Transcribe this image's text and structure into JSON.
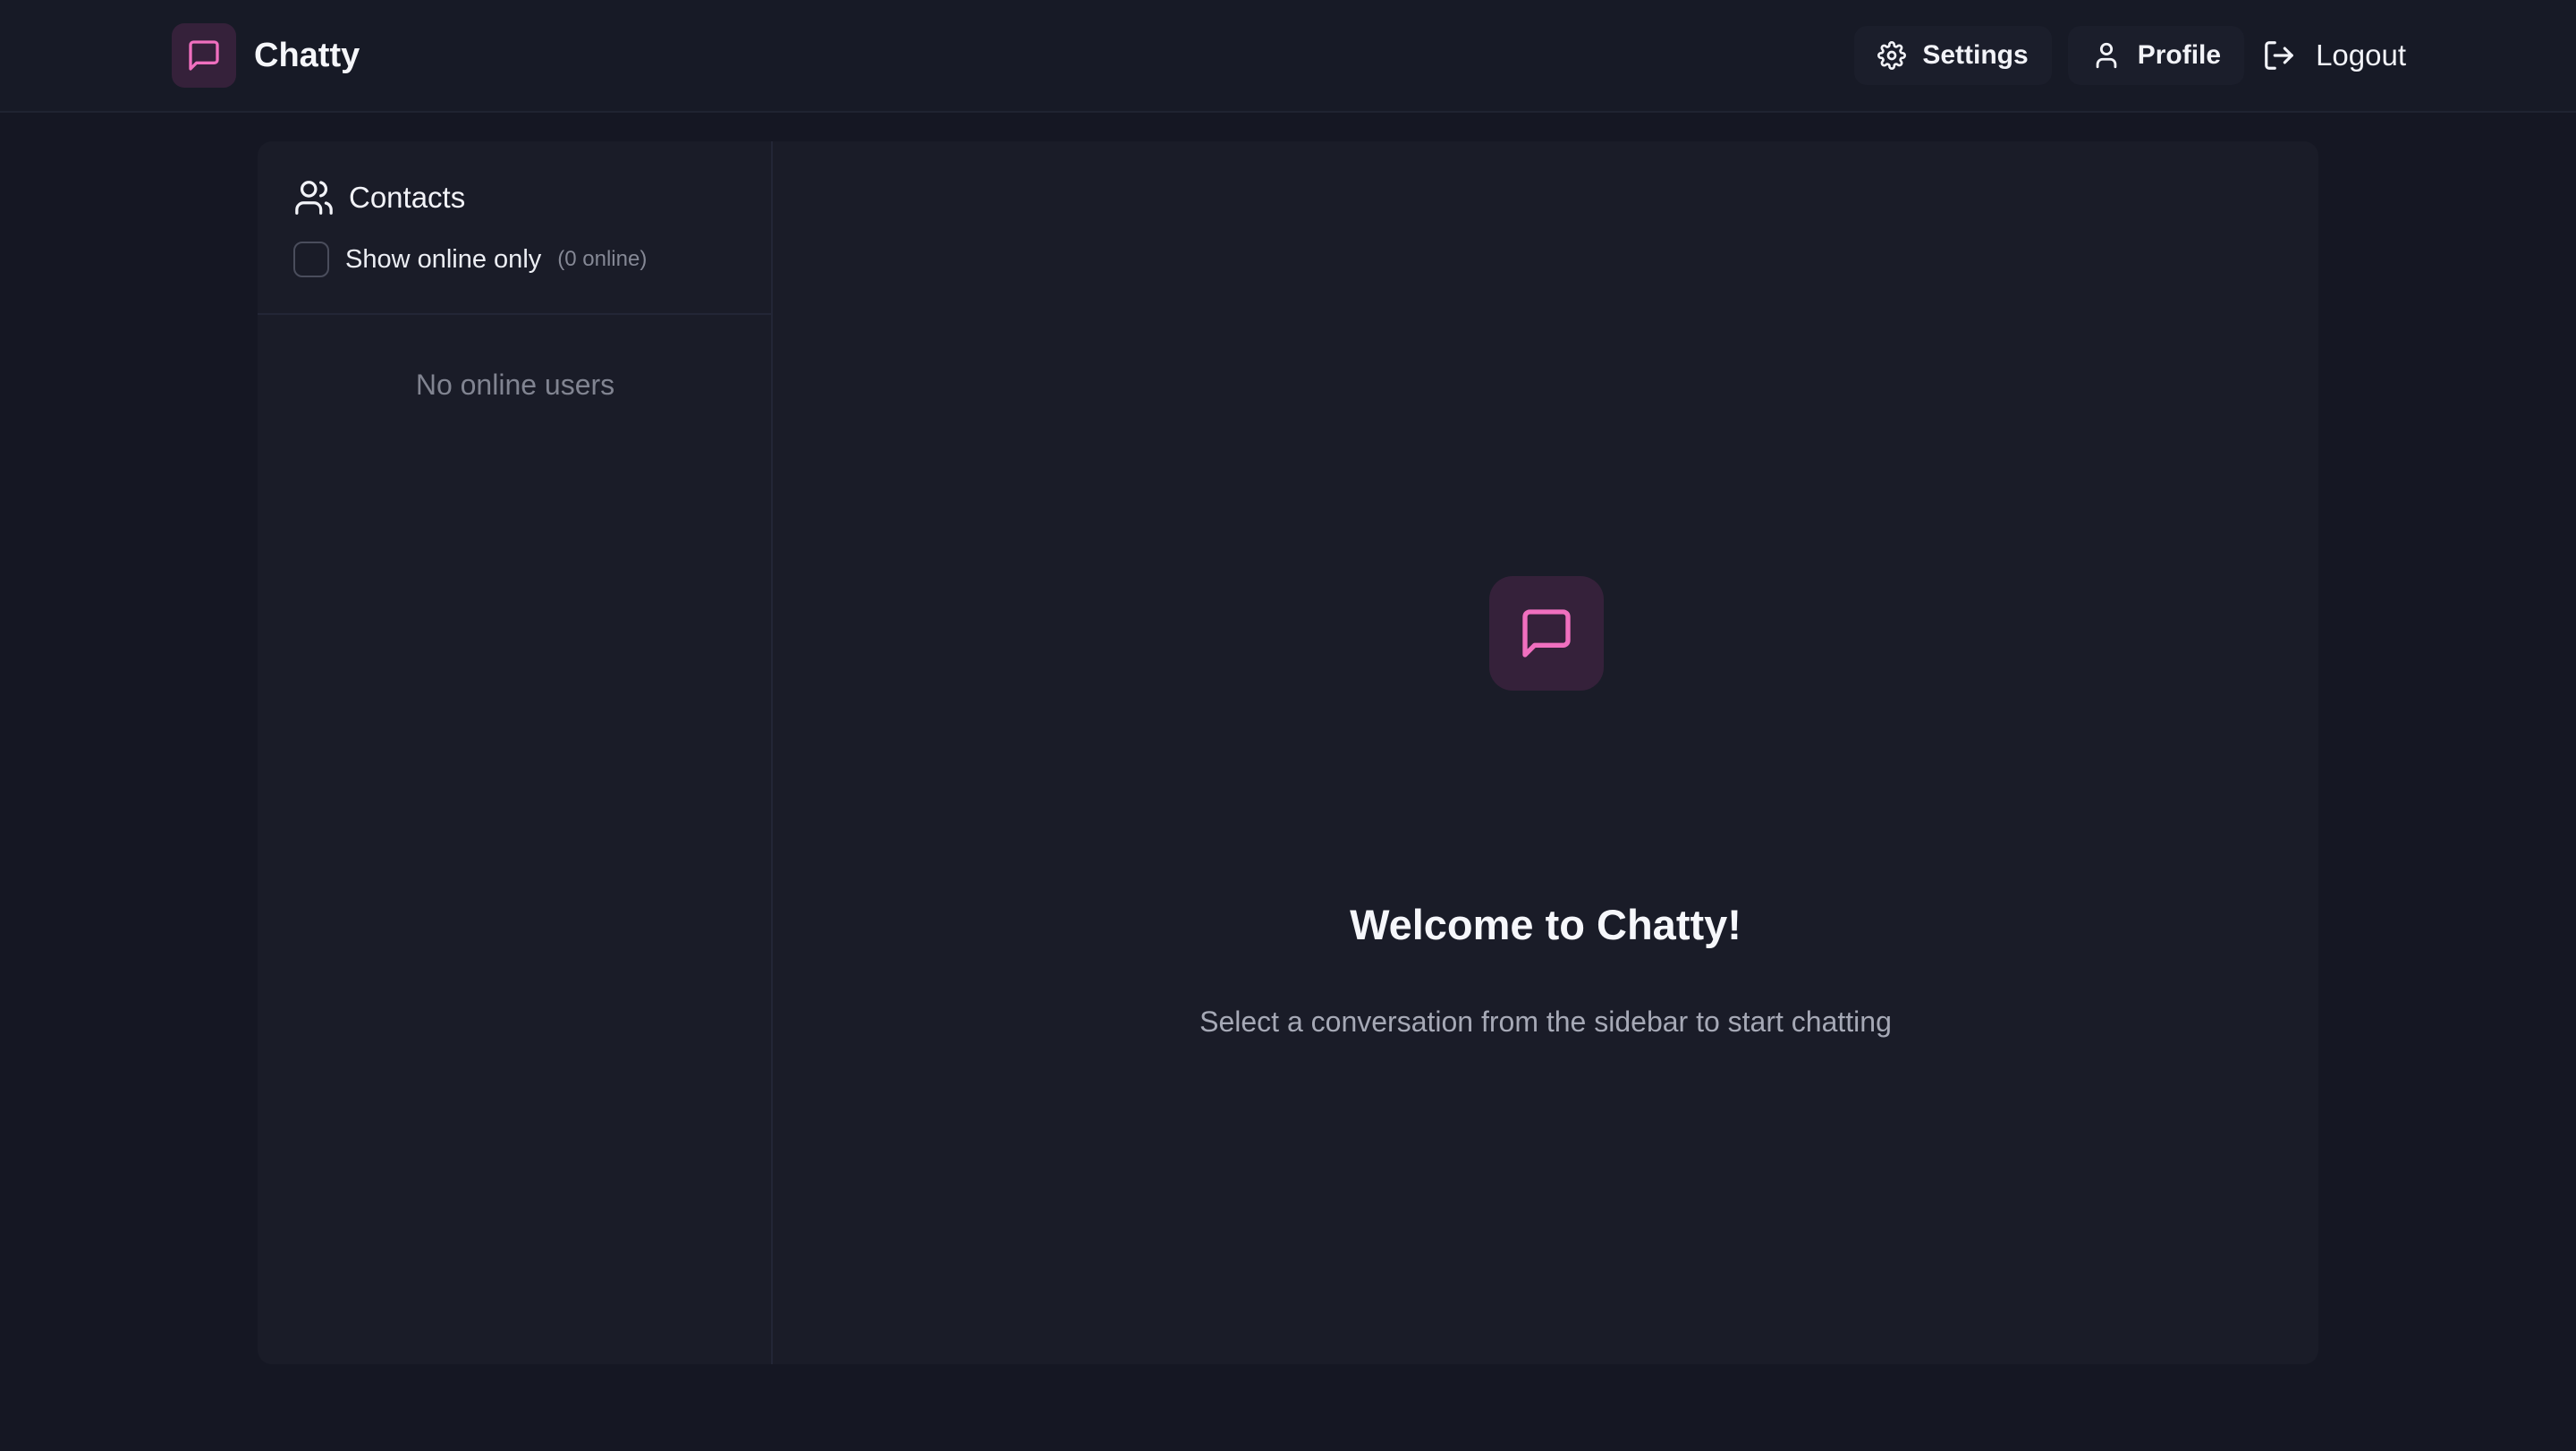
{
  "navbar": {
    "brand": "Chatty",
    "settings_label": "Settings",
    "profile_label": "Profile",
    "logout_label": "Logout"
  },
  "sidebar": {
    "title": "Contacts",
    "show_online_label": "Show online only",
    "online_count": "(0 online)",
    "show_online_checked": false,
    "empty_text": "No online users"
  },
  "main": {
    "welcome_title": "Welcome to Chatty!",
    "welcome_subtitle": "Select a conversation from the sidebar to start chatting"
  },
  "icons": {
    "brand": "message-square-icon",
    "settings": "gear-icon",
    "profile": "user-icon",
    "logout": "logout-icon",
    "contacts": "users-icon",
    "welcome": "message-square-icon"
  },
  "colors": {
    "accent": "#f06fbf",
    "background": "#151723",
    "card": "#1a1c28",
    "icon_tile": "#35213a"
  }
}
